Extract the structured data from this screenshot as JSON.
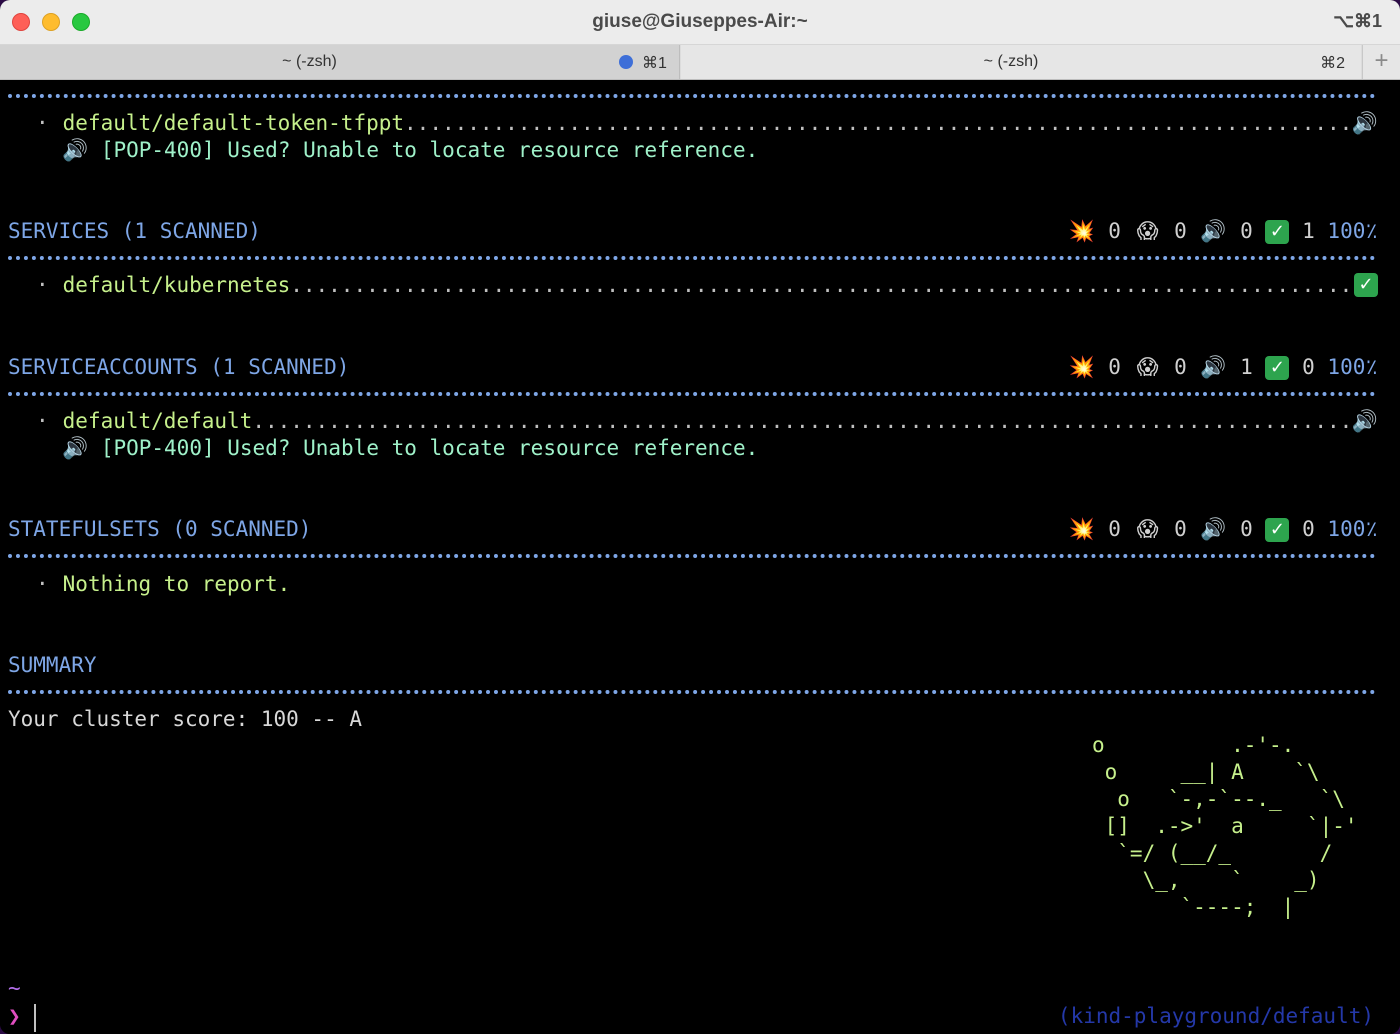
{
  "window": {
    "title": "giuse@Giuseppes-Air:~",
    "shortcut": "⌥⌘1"
  },
  "tabs": [
    {
      "label": "~ (-zsh)",
      "shortcut": "⌘1",
      "active": true
    },
    {
      "label": "~ (-zsh)",
      "shortcut": "⌘2",
      "active": false
    }
  ],
  "tab_add_label": "+",
  "icons": {
    "error": "💥",
    "warning": "😱",
    "info": "🔊",
    "ok": "✓"
  },
  "top_block": {
    "item": "default/default-token-tfppt",
    "message": "[POP-400] Used? Unable to locate resource reference."
  },
  "sections": [
    {
      "title": "SERVICES (1 SCANNED)",
      "counts": {
        "error": "0",
        "warning": "0",
        "info": "0",
        "ok": "1"
      },
      "percent": "100٪",
      "item": "default/kubernetes",
      "message": ""
    },
    {
      "title": "SERVICEACCOUNTS (1 SCANNED)",
      "counts": {
        "error": "0",
        "warning": "0",
        "info": "1",
        "ok": "0"
      },
      "percent": "100٪",
      "item": "default/default",
      "message": "[POP-400] Used? Unable to locate resource reference."
    },
    {
      "title": "STATEFULSETS (0 SCANNED)",
      "counts": {
        "error": "0",
        "warning": "0",
        "info": "0",
        "ok": "0"
      },
      "percent": "100٪",
      "item": "Nothing to report.",
      "message": ""
    }
  ],
  "summary": {
    "title": "SUMMARY",
    "score_line": "Your cluster score: 100 -- A",
    "ascii_art": "o          .-'-.\n o     __| A    `\\\n  o   `-,-`--._   `\\\n []  .->'  a     `|-'\n  `=/ (__/_       /\n    \\_,    `    _)\n       `----;  |"
  },
  "prompt": {
    "tilde": "~",
    "arrow": "❯",
    "context": "(kind-playground/default)"
  }
}
